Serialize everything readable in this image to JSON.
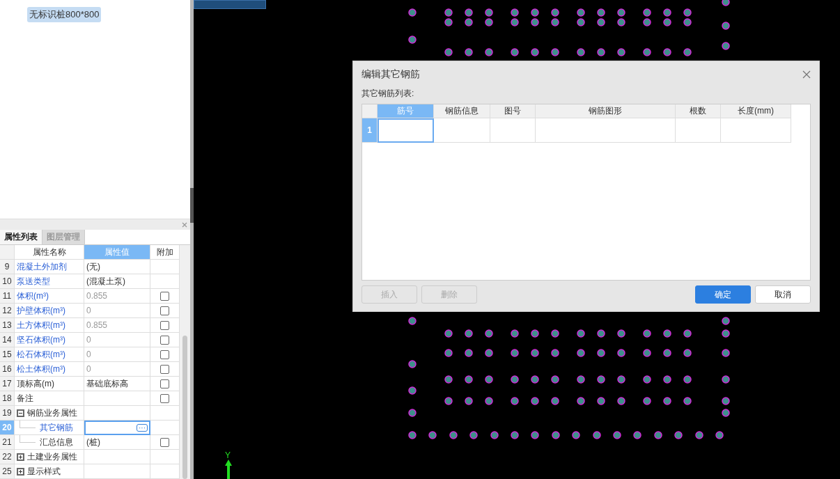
{
  "tree": {
    "items": [
      {
        "label": "无标识桩800*800",
        "selected": true
      }
    ]
  },
  "property_panel": {
    "tabs": [
      {
        "label": "属性列表",
        "selected": true
      },
      {
        "label": "图层管理",
        "selected": false
      }
    ],
    "columns": [
      {
        "label": "属性名称",
        "selected": false
      },
      {
        "label": "属性值",
        "selected": true
      },
      {
        "label": "附加",
        "selected": false
      }
    ],
    "rows": [
      {
        "num": "9",
        "name": "混凝土外加剂",
        "value": "(无)",
        "link": true,
        "dim": false,
        "kind": "plain",
        "selected": false
      },
      {
        "num": "10",
        "name": "泵送类型",
        "value": "(混凝土泵)",
        "link": true,
        "dim": false,
        "kind": "plain",
        "selected": false
      },
      {
        "num": "11",
        "name": "体积(m³)",
        "value": "0.855",
        "link": true,
        "dim": true,
        "kind": "checkbox",
        "checked": false,
        "selected": false
      },
      {
        "num": "12",
        "name": "护壁体积(m³)",
        "value": "0",
        "link": true,
        "dim": true,
        "kind": "checkbox",
        "checked": false,
        "selected": false
      },
      {
        "num": "13",
        "name": "土方体积(m³)",
        "value": "0.855",
        "link": true,
        "dim": true,
        "kind": "checkbox",
        "checked": false,
        "selected": false
      },
      {
        "num": "14",
        "name": "坚石体积(m³)",
        "value": "0",
        "link": true,
        "dim": true,
        "kind": "checkbox",
        "checked": false,
        "selected": false
      },
      {
        "num": "15",
        "name": "松石体积(m³)",
        "value": "0",
        "link": true,
        "dim": true,
        "kind": "checkbox",
        "checked": false,
        "selected": false
      },
      {
        "num": "16",
        "name": "松土体积(m³)",
        "value": "0",
        "link": true,
        "dim": true,
        "kind": "checkbox",
        "checked": false,
        "selected": false
      },
      {
        "num": "17",
        "name": "顶标高(m)",
        "value": "基础底标高",
        "link": false,
        "dim": false,
        "kind": "checkbox",
        "checked": false,
        "selected": false
      },
      {
        "num": "18",
        "name": "备注",
        "link": false,
        "kind": "checkbox",
        "checked": false,
        "selected": false
      },
      {
        "num": "19",
        "name": "钢筋业务属性",
        "kind": "group",
        "expanded": true,
        "selected": false,
        "children": [
          {
            "num": "20",
            "name": "其它钢筋",
            "link": true,
            "kind": "editing",
            "value_button": "···",
            "selected": true
          },
          {
            "num": "21",
            "name": "汇总信息",
            "value": "(桩)",
            "link": false,
            "dim": false,
            "kind": "checkbox",
            "checked": false,
            "selected": false
          }
        ]
      },
      {
        "num": "22",
        "name": "土建业务属性",
        "kind": "group",
        "expanded": false,
        "selected": false
      },
      {
        "num": "25",
        "name": "显示样式",
        "kind": "group",
        "expanded": false,
        "selected": false
      }
    ]
  },
  "canvas": {
    "axis_label": "Y"
  },
  "dialog": {
    "title": "编辑其它钢筋",
    "list_label": "其它钢筋列表:",
    "columns": [
      {
        "label": "筋号",
        "selected": true
      },
      {
        "label": "钢筋信息",
        "selected": false
      },
      {
        "label": "图号",
        "selected": false
      },
      {
        "label": "钢筋图形",
        "selected": false
      },
      {
        "label": "根数",
        "selected": false
      },
      {
        "label": "长度(mm)",
        "selected": false
      }
    ],
    "rows": [
      {
        "num": "1",
        "selected": true
      }
    ],
    "buttons": [
      {
        "label": "插入",
        "kind": "secondary",
        "disabled": true
      },
      {
        "label": "删除",
        "kind": "secondary",
        "disabled": true
      },
      {
        "label": "确定",
        "kind": "primary",
        "disabled": false
      },
      {
        "label": "取消",
        "kind": "secondary",
        "disabled": false
      }
    ]
  }
}
